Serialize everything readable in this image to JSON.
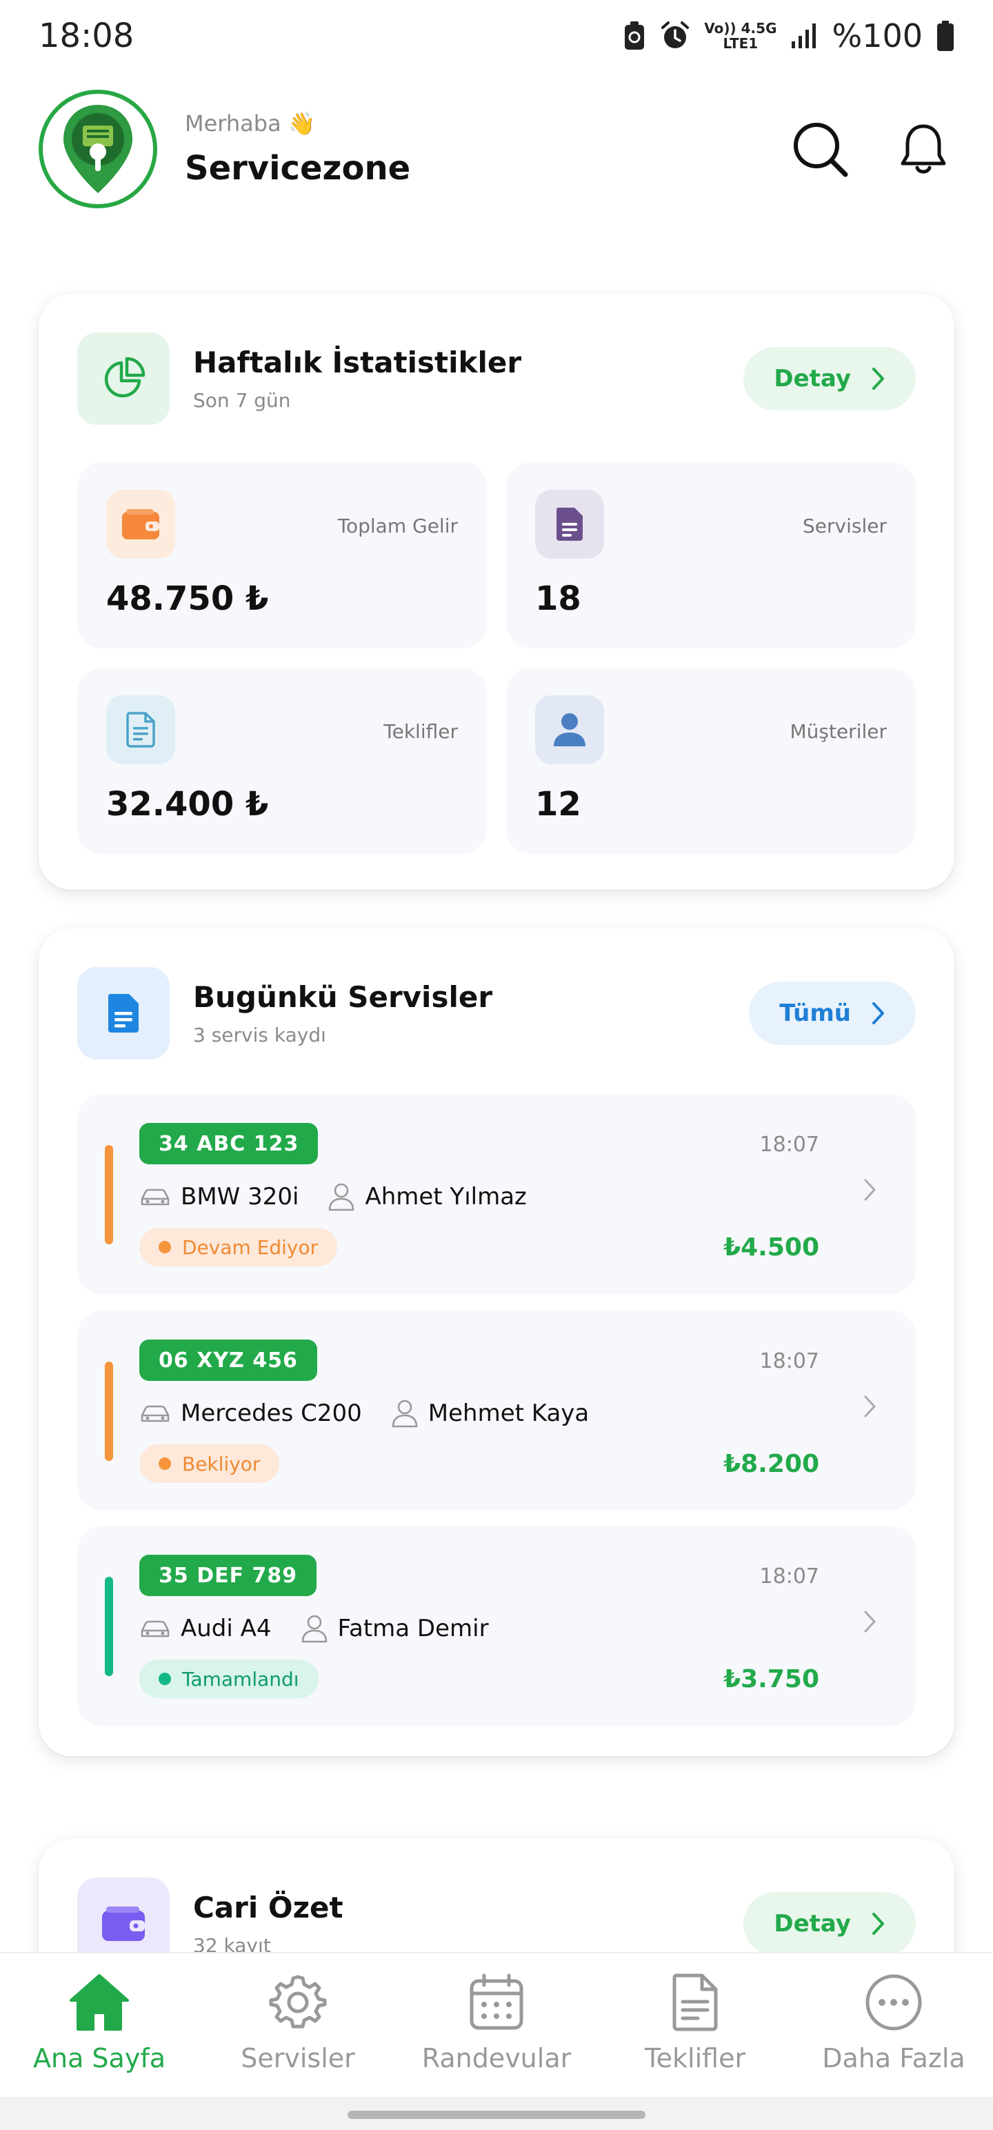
{
  "status_bar": {
    "time": "18:08",
    "network_top": "Vo)) 4.5G",
    "network_bottom": "LTE1",
    "battery": "%100"
  },
  "header": {
    "greeting": "Merhaba 👋",
    "app_name": "Servicezone"
  },
  "weekly_stats": {
    "title": "Haftalık İstatistikler",
    "subtitle": "Son 7 gün",
    "detail_label": "Detay",
    "items": [
      {
        "label": "Toplam Gelir",
        "value": "48.750 ₺",
        "icon": "wallet-icon",
        "color": "#f5883a"
      },
      {
        "label": "Servisler",
        "value": "18",
        "icon": "document-icon",
        "color": "#6b4f8c"
      },
      {
        "label": "Teklifler",
        "value": "32.400 ₺",
        "icon": "file-lines-icon",
        "color": "#4aa3c8"
      },
      {
        "label": "Müşteriler",
        "value": "12",
        "icon": "user-icon",
        "color": "#4a7fc1"
      }
    ]
  },
  "today_services": {
    "title": "Bugünkü Servisler",
    "subtitle": "3 servis kaydı",
    "all_label": "Tümü",
    "items": [
      {
        "plate": "34 ABC 123",
        "time": "18:07",
        "car": "BMW 320i",
        "customer": "Ahmet Yılmaz",
        "status": "Devam Ediyor",
        "amount": "₺4.500",
        "status_color": "#f5943a"
      },
      {
        "plate": "06 XYZ 456",
        "time": "18:07",
        "car": "Mercedes C200",
        "customer": "Mehmet Kaya",
        "status": "Bekliyor",
        "amount": "₺8.200",
        "status_color": "#f5943a"
      },
      {
        "plate": "35 DEF 789",
        "time": "18:07",
        "car": "Audi A4",
        "customer": "Fatma Demir",
        "status": "Tamamlandı",
        "amount": "₺3.750",
        "status_color": "#13b886"
      }
    ]
  },
  "cari_summary": {
    "title": "Cari Özet",
    "subtitle": "32 kayıt",
    "detail_label": "Detay"
  },
  "bottom_nav": {
    "items": [
      {
        "label": "Ana Sayfa",
        "icon": "home-icon",
        "active": true
      },
      {
        "label": "Servisler",
        "icon": "gear-icon",
        "active": false
      },
      {
        "label": "Randevular",
        "icon": "calendar-icon",
        "active": false
      },
      {
        "label": "Teklifler",
        "icon": "document-icon",
        "active": false
      },
      {
        "label": "Daha Fazla",
        "icon": "more-icon",
        "active": false
      }
    ]
  },
  "colors": {
    "brand_green": "#22a94a",
    "card_bg": "#f6f8fc",
    "muted_text": "#8a8a8a"
  }
}
